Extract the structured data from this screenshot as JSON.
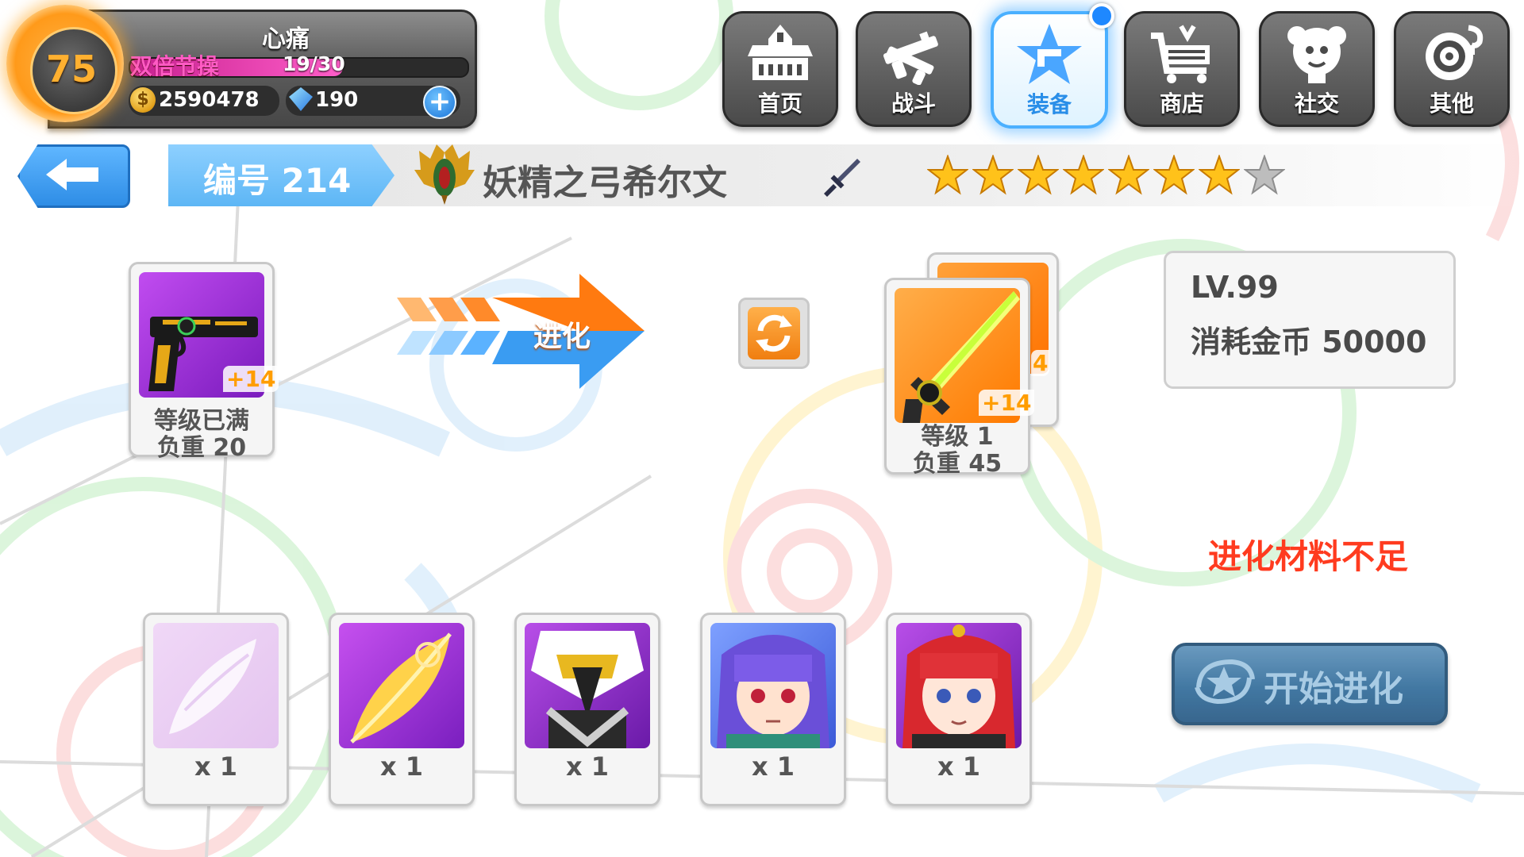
{
  "player": {
    "level": "75",
    "name": "心痛",
    "stamina_label": "双倍节操",
    "stamina_text": "19/30",
    "stamina_fraction": 0.63,
    "coins": "2590478",
    "gems": "190"
  },
  "nav": [
    {
      "label": "首页",
      "icon": "home-icon"
    },
    {
      "label": "战斗",
      "icon": "battle-icon"
    },
    {
      "label": "装备",
      "icon": "equipment-icon",
      "active": true
    },
    {
      "label": "商店",
      "icon": "shop-icon"
    },
    {
      "label": "社交",
      "icon": "social-icon"
    },
    {
      "label": "其他",
      "icon": "other-icon"
    }
  ],
  "header": {
    "number": "编号 214",
    "item_name": "妖精之弓希尔文",
    "stars_filled": 7,
    "stars_total": 8
  },
  "source_card": {
    "plus": "+14",
    "line1": "等级已满",
    "line2": "负重 20"
  },
  "evolve_arrow_label": "进化",
  "result_card": {
    "plus": "+14",
    "back_plus": "4",
    "line1": "等级 1",
    "line2": "负重 45"
  },
  "info": {
    "level": "LV.99",
    "cost": "消耗金币 50000"
  },
  "warning": "进化材料不足",
  "start_button": "开始进化",
  "materials": [
    {
      "count": "x 1",
      "icon": "faded-wing-icon"
    },
    {
      "count": "x 1",
      "icon": "golden-wing-icon"
    },
    {
      "count": "x 1",
      "icon": "eagle-mask-character-icon"
    },
    {
      "count": "x 1",
      "icon": "purple-hair-elf-icon"
    },
    {
      "count": "x 1",
      "icon": "red-hair-elf-icon"
    }
  ],
  "colors": {
    "accent_blue": "#4bb0ff",
    "warning_red": "#ff3b1f",
    "level_orange": "#ff9a1a",
    "star_gold": "#ffc21a"
  }
}
